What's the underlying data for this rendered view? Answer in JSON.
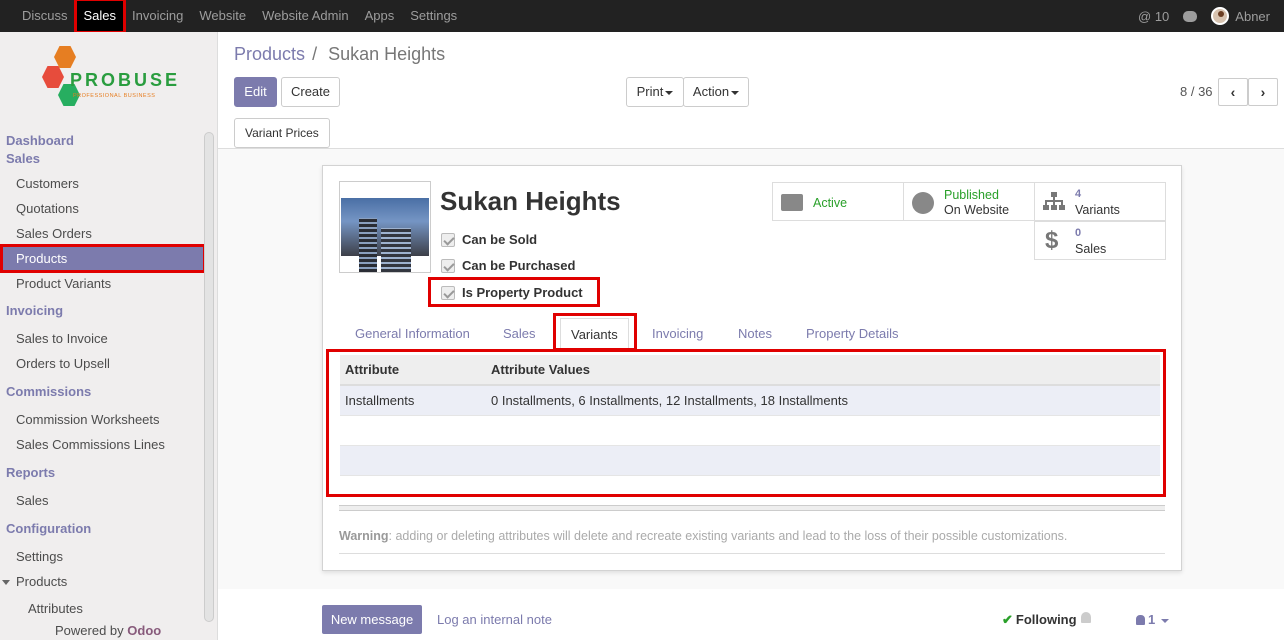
{
  "topbar": {
    "menu": [
      "Discuss",
      "Sales",
      "Invoicing",
      "Website",
      "Website Admin",
      "Apps",
      "Settings"
    ],
    "active_menu": "Sales",
    "mentions": "@ 10",
    "user": "Abner"
  },
  "logo": {
    "brand": "PROBUSE",
    "tagline": "PROFESSIONAL BUSINESS"
  },
  "sidebar": {
    "dashboard": "Dashboard",
    "sales_section": "Sales",
    "sales_items": [
      "Customers",
      "Quotations",
      "Sales Orders",
      "Products",
      "Product Variants"
    ],
    "invoicing_section": "Invoicing",
    "invoicing_items": [
      "Sales to Invoice",
      "Orders to Upsell"
    ],
    "commissions_section": "Commissions",
    "commissions_items": [
      "Commission Worksheets",
      "Sales Commissions Lines"
    ],
    "reports_section": "Reports",
    "reports_items": [
      "Sales"
    ],
    "configuration_section": "Configuration",
    "config_items": [
      "Settings",
      "Products",
      "Attributes"
    ],
    "powered_prefix": "Powered by",
    "powered_brand": "Odoo"
  },
  "breadcrumb": {
    "parent": "Products",
    "sep": "/",
    "current": "Sukan Heights"
  },
  "toolbar": {
    "edit": "Edit",
    "create": "Create",
    "print": "Print",
    "action": "Action"
  },
  "pager": {
    "text": "8 / 36",
    "prev": "‹",
    "next": "›"
  },
  "statusbar": {
    "variant_prices": "Variant Prices"
  },
  "product": {
    "name": "Sukan Heights",
    "checkboxes": [
      "Can be Sold",
      "Can be Purchased",
      "Is Property Product"
    ]
  },
  "smart_buttons": {
    "active": "Active",
    "published_l1": "Published",
    "published_l2": "On Website",
    "variants_count": "4",
    "variants_label": "Variants",
    "sales_count": "0",
    "sales_label": "Sales"
  },
  "tabs": [
    "General Information",
    "Sales",
    "Variants",
    "Invoicing",
    "Notes",
    "Property Details"
  ],
  "active_tab": "Variants",
  "attributes_table": {
    "headers": [
      "Attribute",
      "Attribute Values"
    ],
    "rows": [
      [
        "Installments",
        "0 Installments, 6 Installments, 12 Installments, 18 Installments"
      ]
    ]
  },
  "warning": {
    "label": "Warning",
    "text": ": adding or deleting attributes will delete and recreate existing variants and lead to the loss of their possible customizations."
  },
  "chatter": {
    "new_message": "New message",
    "log_note": "Log an internal note",
    "following": "Following",
    "followers": "1"
  },
  "colors": {
    "accent": "#7c7bad",
    "highlight": "#e00000",
    "topbar": "#222222",
    "active_green": "#2aa02a"
  }
}
